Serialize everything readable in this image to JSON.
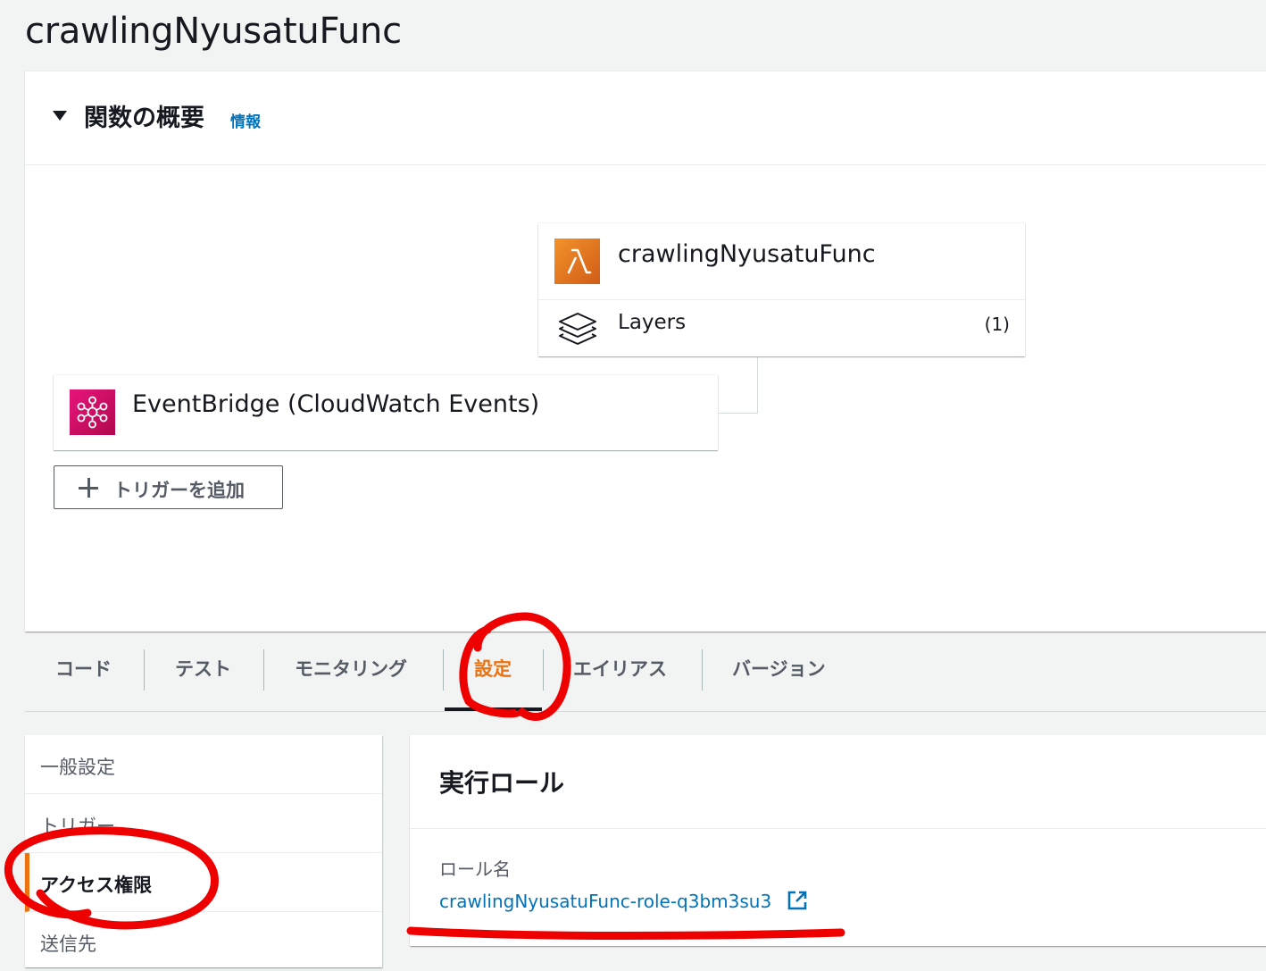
{
  "page": {
    "title": "crawlingNyusatuFunc"
  },
  "overview": {
    "title": "関数の概要",
    "info_link": "情報",
    "function": {
      "name": "crawlingNyusatuFunc",
      "icon": "lambda-icon",
      "layers_label": "Layers",
      "layers_count": "(1)"
    },
    "trigger": {
      "label": "EventBridge (CloudWatch Events)",
      "icon": "eventbridge-icon"
    },
    "add_trigger_label": "トリガーを追加"
  },
  "tabs": [
    {
      "label": "コード"
    },
    {
      "label": "テスト"
    },
    {
      "label": "モニタリング"
    },
    {
      "label": "設定",
      "active": true
    },
    {
      "label": "エイリアス"
    },
    {
      "label": "バージョン"
    }
  ],
  "settings_nav": [
    {
      "label": "一般設定"
    },
    {
      "label": "トリガー"
    },
    {
      "label": "アクセス権限",
      "active": true
    },
    {
      "label": "送信先"
    }
  ],
  "execution_role": {
    "title": "実行ロール",
    "role_name_label": "ロール名",
    "role_name": "crawlingNyusatuFunc-role-q3bm3su3"
  },
  "colors": {
    "link": "#0073bb",
    "active_accent": "#ec7211",
    "annotation": "#ee0000",
    "lambda_icon": "#e8842a",
    "eventbridge_icon": "#d6206a"
  }
}
